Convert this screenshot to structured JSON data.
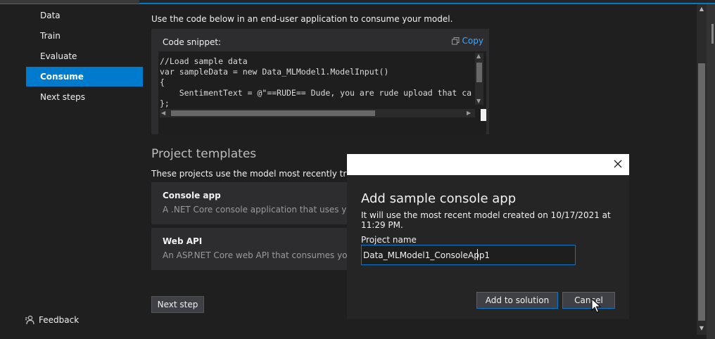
{
  "sidebar": {
    "items": [
      {
        "label": "Data"
      },
      {
        "label": "Train"
      },
      {
        "label": "Evaluate"
      },
      {
        "label": "Consume",
        "selected": true
      },
      {
        "label": "Next steps"
      }
    ],
    "feedback_label": "Feedback",
    "feedback_icon": "feedback-person-icon"
  },
  "main": {
    "description": "Use the code below in an end-user application to consume your model.",
    "code_snippet": {
      "title": "Code snippet:",
      "copy_label": "Copy",
      "lines": [
        "//Load sample data",
        "var sampleData = new Data_MLModel1.ModelInput()",
        "{",
        "    SentimentText = @\"==RUDE== Dude, you are rude upload that ca",
        "};"
      ]
    },
    "project_templates": {
      "title": "Project templates",
      "description": "These projects use the model most recently trained o",
      "items": [
        {
          "name": "Console app",
          "description": "A .NET Core console application that uses your mo"
        },
        {
          "name": "Web API",
          "description": "An ASP.NET Core web API that consumes your mo"
        }
      ]
    },
    "next_step_label": "Next step"
  },
  "dialog": {
    "title": "Add sample console app",
    "subtitle": "It will use the most recent model created on 10/17/2021 at 11:29 PM.",
    "project_name_label": "Project name",
    "project_name_value": "Data_MLModel1_ConsoleApp1",
    "add_button_label": "Add to solution",
    "cancel_button_label": "Cancel"
  },
  "colors": {
    "accent": "#007acc",
    "background": "#1f1f1f",
    "panel": "#2d2d30",
    "link": "#3ea8ff"
  }
}
